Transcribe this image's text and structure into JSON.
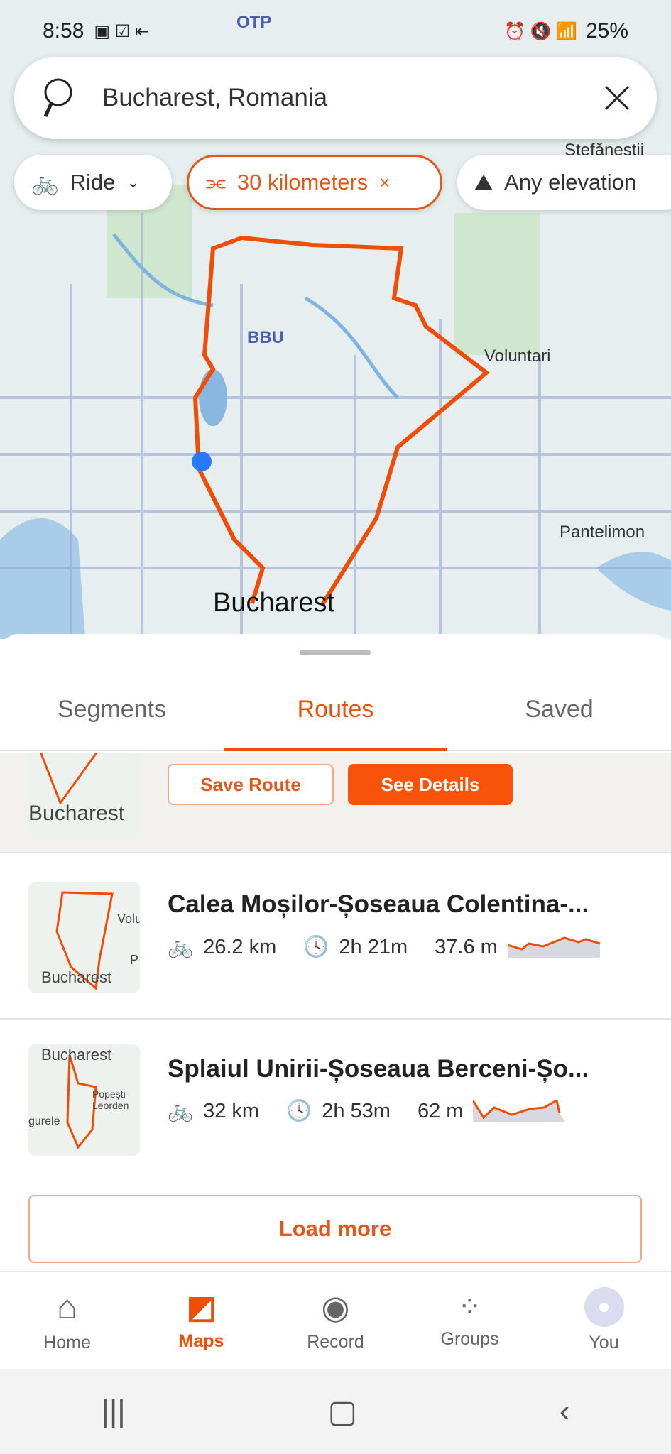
{
  "status_bar": {
    "time": "8:58",
    "battery": "25%"
  },
  "map": {
    "labels": {
      "otp": "OTP",
      "bbu": "BBU",
      "voluntari": "Voluntari",
      "pantelimon": "Pantelimon",
      "stefanestii": "Ștefăneștii",
      "bucharest": "Bucharest"
    },
    "route_color": "#f04e08"
  },
  "search": {
    "value": "Bucharest, Romania"
  },
  "filters": {
    "sport": "Ride",
    "distance": "30 kilometers",
    "elevation": "Any elevation"
  },
  "tabs": [
    {
      "label": "Segments"
    },
    {
      "label": "Routes"
    },
    {
      "label": "Saved"
    }
  ],
  "selected_card": {
    "thumb_label": "Bucharest",
    "save_label": "Save Route",
    "details_label": "See Details"
  },
  "routes": [
    {
      "title": "Calea Moșilor-Șoseaua Colentina-...",
      "distance": "26.2 km",
      "time": "2h 21m",
      "elevation": "37.6 m",
      "thumb_labels": [
        "Volu",
        "Bucharest",
        "P"
      ]
    },
    {
      "title": "Splaiul Unirii-Șoseaua Berceni-Șo...",
      "distance": "32 km",
      "time": "2h 53m",
      "elevation": "62 m",
      "thumb_labels": [
        "Bucharest",
        "Popești-Leorden",
        "gurele"
      ]
    }
  ],
  "load_more": "Load more",
  "nav": [
    {
      "label": "Home"
    },
    {
      "label": "Maps"
    },
    {
      "label": "Record"
    },
    {
      "label": "Groups"
    },
    {
      "label": "You"
    }
  ],
  "accent": "#f04e08"
}
